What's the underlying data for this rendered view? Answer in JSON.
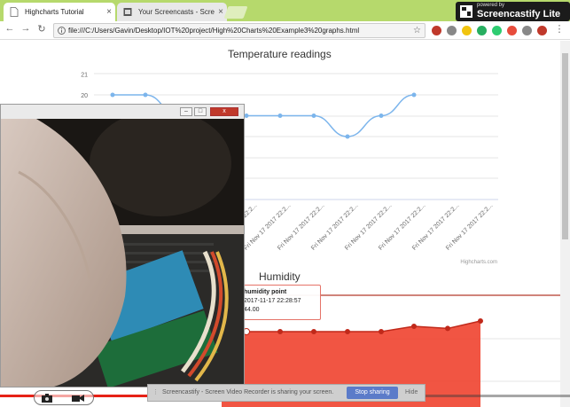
{
  "browser": {
    "tabs": [
      {
        "label": "Highcharts Tutorial",
        "active": true
      },
      {
        "label": "Your Screencasts - Scre",
        "active": false
      }
    ],
    "url": "file:///C:/Users/Gavin/Desktop/IOT%20project/High%20Charts%20Example3%20graphs.html",
    "screencastify_badge": {
      "small": "powered by",
      "title": "Screencastify Lite"
    }
  },
  "temperature_chart": {
    "chart_data": {
      "type": "line",
      "title": "Temperature readings",
      "y_ticks_visible": [
        "21",
        "20"
      ],
      "ylim_visible": [
        20,
        21
      ],
      "categories": [
        "Fri Nov 17 2017 22:2...",
        "Fri Nov 17 2017 22:2...",
        "Fri Nov 17 2017 22:2...",
        "Fri Nov 17 2017 22:2...",
        "Fri Nov 17 2017 22:2...",
        "Fri Nov 17 2017 22:2...",
        "Fri Nov 17 2017 22:2...",
        "Fri Nov 17 2017 22:2..."
      ],
      "series": [
        {
          "values": [
            20,
            20,
            19,
            19,
            19,
            19,
            19,
            18,
            19,
            20
          ]
        }
      ],
      "credits": "Highcharts.com",
      "color": "#7cb5ec"
    }
  },
  "humidity_chart": {
    "chart_data": {
      "type": "area",
      "title": "Humidity",
      "series": [
        {
          "values": [
            44,
            44,
            44,
            44,
            44,
            44,
            44.5,
            44.3,
            45
          ]
        }
      ],
      "color": "#f0432f"
    },
    "tooltip": {
      "title": "humidity point",
      "time": "2017-11-17 22:28:57",
      "value": "44.00"
    }
  },
  "webcam": {
    "buttons": [
      "–",
      "□",
      "x"
    ]
  },
  "sharebar": {
    "text": "Screencastify - Screen Video Recorder is sharing your screen.",
    "stop_label": "Stop sharing",
    "hide_label": "Hide"
  }
}
